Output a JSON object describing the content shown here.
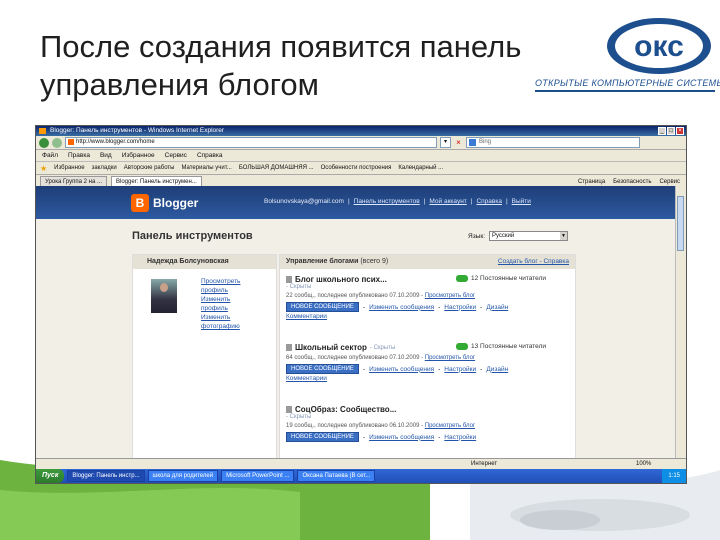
{
  "slide": {
    "title": "После создания появится панель управления блогом",
    "logo_mark": "окс",
    "logo_subtitle": "ОТКРЫТЫЕ КОМПЬЮТЕРНЫЕ СИСТЕМЫ",
    "accent_color": "#1d4f8f"
  },
  "browser": {
    "window_title": "Blogger: Панель инструментов - Windows Internet Explorer",
    "address": "http://www.blogger.com/home",
    "search_placeholder": "Bing",
    "menu": [
      "Файл",
      "Правка",
      "Вид",
      "Избранное",
      "Сервис",
      "Справка"
    ],
    "favorites_label": "Избранное",
    "favorites": [
      "закладки",
      "Авторские работы",
      "Материалы учит...",
      "БОЛЬШАЯ ДОМАШНЯЯ ...",
      "Особенности построения",
      "Календарный ..."
    ],
    "tabs": [
      "Урока Группа 2 на ...",
      "Blogger: Панель инструмен..."
    ],
    "tab_tools": [
      "Страница",
      "Безопасность",
      "Сервис"
    ]
  },
  "blogger": {
    "logo_text": "Blogger",
    "user_email": "Bolsunovskaya@gmail.com",
    "top_links": [
      "Панель инструментов",
      "Мой аккаунт",
      "Справка",
      "Выйти"
    ],
    "dashboard_title": "Панель инструментов",
    "language_label": "Язык:",
    "language_value": "Русский",
    "profile": {
      "name": "Надежда Болсуновская",
      "links": [
        "Просмотреть профиль",
        "Изменить профиль",
        "Изменить фотографию"
      ]
    },
    "manage": {
      "heading": "Управление блогами",
      "count": "(всего 9)",
      "create_link": "Создать блог - Справка"
    },
    "blogs": [
      {
        "name": "Блог школьного псих...",
        "hidden": "- Скрыты",
        "readers": "12 Постоянные читатели",
        "meta": "22 сообщ., последнее опубликовано 07.10.2009 -",
        "view_link": "Просмотреть блог",
        "new_post": "НОВОЕ СООБЩЕНИЕ",
        "actions": [
          "Изменить сообщения",
          "Настройки",
          "Дизайн"
        ],
        "extra": "Комментарии"
      },
      {
        "name": "Школьный сектор",
        "hidden": "- Скрыты",
        "readers": "13 Постоянные читатели",
        "meta": "64 сообщ., последнее опубликовано 07.10.2009 -",
        "view_link": "Просмотреть блог",
        "new_post": "НОВОЕ СООБЩЕНИЕ",
        "actions": [
          "Изменить сообщения",
          "Настройки",
          "Дизайн"
        ],
        "extra": "Комментарии"
      },
      {
        "name": "СоцОбраз: Сообщество...",
        "hidden": "- Скрыты",
        "readers": "",
        "meta": "19 сообщ., последнее опубликовано 06.10.2009 -",
        "view_link": "Просмотреть блог",
        "new_post": "НОВОЕ СООБЩЕНИЕ",
        "actions": [
          "Изменить сообщения",
          "Настройки"
        ],
        "extra": ""
      }
    ]
  },
  "status": {
    "zone": "Интернет",
    "zoom": "100%"
  },
  "taskbar": {
    "start": "Пуск",
    "items": [
      "Blogger: Панель инстр...",
      "школа для родителей",
      "Microsoft PowerPoint ...",
      "Оксана Патаева (В сет..."
    ],
    "clock": "1:15"
  }
}
